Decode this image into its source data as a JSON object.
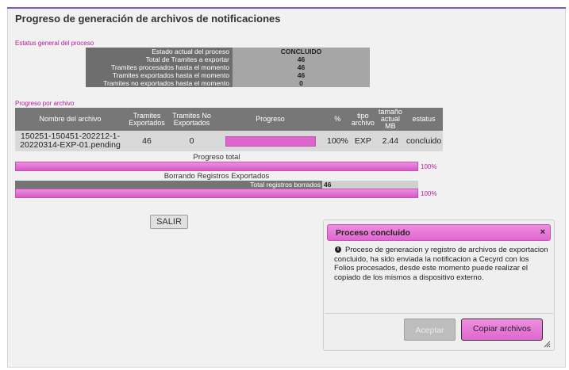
{
  "page": {
    "title": "Progreso de generación de archivos de notificaciones"
  },
  "summary": {
    "section_title": "Estatus general del proceso",
    "rows": [
      {
        "label": "Estado actual del proceso",
        "value": "CONCLUIDO"
      },
      {
        "label": "Total de Tramites a exportar",
        "value": "46"
      },
      {
        "label": "Tramites procesados hasta el momento",
        "value": "46"
      },
      {
        "label": "Tramites exportados hasta el momento",
        "value": "46"
      },
      {
        "label": "Tramites no exportados hasta el momento",
        "value": "0"
      }
    ]
  },
  "files": {
    "section_title": "Progreso por archivo",
    "headers": {
      "name": "Nombre del archivo",
      "exported": "Tramites Exportados",
      "not_exported": "Tramites No Exportados",
      "progress": "Progreso",
      "pct": "%",
      "type": "tipo archivo",
      "size": "tamaño actual MB",
      "status": "estatus"
    },
    "rows": [
      {
        "name": "150251-150451-202212-1-20220314-EXP-01.pending",
        "exported": "46",
        "not_exported": "0",
        "progress_fraction": 1.0,
        "pct": "100%",
        "type": "EXP",
        "size": "2.44",
        "status": "concluido"
      }
    ]
  },
  "total_progress": {
    "label": "Progreso total",
    "pct": "100%",
    "fraction": 1.0
  },
  "deletion": {
    "label": "Borrando Registros Exportados",
    "total_label": "Total registros borrados",
    "total_value": "46",
    "pct": "100%",
    "fraction": 1.0
  },
  "salir_button": "SALIR",
  "dialog": {
    "title": "Proceso concluido",
    "close": "×",
    "message": "Proceso de generacion y registro de archivos de exportacion concluido, ha sido enviada la notificacion a Cecyrd con los Folios procesados, desde este momento puede realizar el copiado de los mismos a dispositivo externo.",
    "aceptar": "Aceptar",
    "copiar": "Copiar archivos"
  },
  "colors": {
    "accent": "#e066d0",
    "section_text": "#b8179e",
    "header_gray": "#777777"
  }
}
